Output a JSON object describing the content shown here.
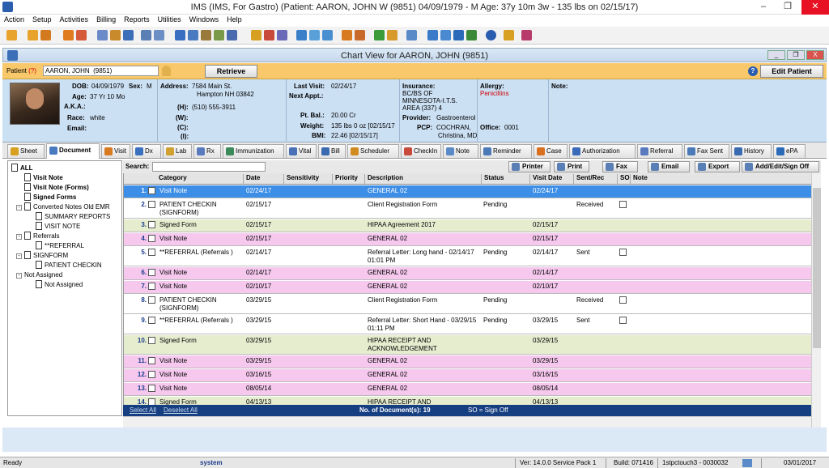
{
  "app": {
    "title": "IMS (IMS, For Gastro)    (Patient: AARON, JOHN W (9851) 04/09/1979 - M Age: 37y 10m 3w - 135 lbs on 02/15/17)",
    "window_controls": [
      "–",
      "❐",
      "✕"
    ]
  },
  "menu": [
    "Action",
    "Setup",
    "Activities",
    "Billing",
    "Reports",
    "Utilities",
    "Windows",
    "Help"
  ],
  "chart_window": {
    "title": "Chart View for AARON, JOHN  (9851)",
    "controls": [
      "_",
      "❐",
      "X"
    ]
  },
  "patient_bar": {
    "label": "Patient",
    "q": "(?)",
    "value": "AARON, JOHN  (9851)",
    "retrieve": "Retrieve",
    "help": "?",
    "edit_patient": "Edit Patient"
  },
  "info": {
    "dob_label": "DOB:",
    "dob": "04/09/1979",
    "sex_label": "Sex:",
    "sex": "M",
    "age_label": "Age:",
    "age": "37 Yr 10 Mo",
    "aka_label": "A.K.A.:",
    "race_label": "Race:",
    "race": "white",
    "email_label": "Email:",
    "address_label": "Address:",
    "address1": "7584 Main St.",
    "address2": "Hampton  NH  03842",
    "h_label": "(H):",
    "h": "(510) 555-3911",
    "w_label": "(W):",
    "c_label": "(C):",
    "i_label": "(I):",
    "last_visit_label": "Last Visit:",
    "last_visit": "02/24/17",
    "next_appt_label": "Next Appt.:",
    "pt_bal_label": "Pt. Bal.:",
    "pt_bal": "20.00 Cr",
    "weight_label": "Weight:",
    "weight": "135 lbs 0 oz [02/15/17",
    "bmi_label": "BMI:",
    "bmi": "22.46 [02/15/17]",
    "insurance_label": "Insurance:",
    "insurance1": "BC/BS OF",
    "insurance2": "MINNESOTA-I.T.S.",
    "insurance3": "AREA  (337)    4",
    "provider_label": "Provider:",
    "provider": "Gastroenterol",
    "pcp_label": "PCP:",
    "pcp1": "COCHRAN,",
    "pcp2": "Christina, MD",
    "allergy_label": "Allergy:",
    "allergy": "Penicillins",
    "office_label": "Office:",
    "office": "0001",
    "note_label": "Note:"
  },
  "tabs": [
    "Sheet",
    "Document",
    "Visit",
    "Dx",
    "Lab",
    "Rx",
    "Immunization",
    "Vital",
    "Bill",
    "Scheduler",
    "CheckIn",
    "Note",
    "Reminder",
    "Case",
    "Authorization",
    "Referral",
    "Fax Sent",
    "History",
    "ePA"
  ],
  "tab_dx_prefix": "Dx",
  "tree": {
    "all": "ALL",
    "visit_note": "Visit Note",
    "visit_note_forms": "Visit Note (Forms)",
    "signed_forms": "Signed Forms",
    "converted": "Converted Notes Old EMR",
    "summary_reports": "SUMMARY REPORTS",
    "visit_note2": "VISIT NOTE",
    "referrals": "Referrals",
    "referral_item": "**REFERRAL",
    "signform": "SIGNFORM",
    "patient_checkin": "PATIENT CHECKIN",
    "not_assigned": "Not Assigned",
    "not_assigned2": "Not Assigned"
  },
  "search": {
    "label": "Search:",
    "printer": "Printer",
    "print": "Print",
    "fax": "Fax",
    "email": "Email",
    "export": "Export",
    "add_edit_sign": "Add/Edit/Sign Off"
  },
  "columns": [
    "Category",
    "Date",
    "Sensitivity",
    "Priority",
    "Description",
    "Status",
    "Visit Date",
    "Sent/Rec",
    "SO",
    "Note"
  ],
  "rows": [
    {
      "num": "1.",
      "category": "Visit Note",
      "date": "02/24/17",
      "description": "GENERAL 02",
      "status": "",
      "visit_date": "02/24/17",
      "sent": "",
      "so": false,
      "bg": "#3d8ee6",
      "selected": true
    },
    {
      "num": "2.",
      "category": "PATIENT CHECKIN (SIGNFORM)",
      "date": "02/15/17",
      "description": "Client Registration Form",
      "status": "Pending",
      "visit_date": "",
      "sent": "Received",
      "so": true,
      "bg": "#ffffff"
    },
    {
      "num": "3.",
      "category": "Signed Form",
      "date": "02/15/17",
      "description": "HIPAA Agreement 2017",
      "status": "",
      "visit_date": "02/15/17",
      "sent": "",
      "so": false,
      "bg": "#e6edcf"
    },
    {
      "num": "4.",
      "category": "Visit Note",
      "date": "02/15/17",
      "description": "GENERAL 02",
      "status": "",
      "visit_date": "02/15/17",
      "sent": "",
      "so": false,
      "bg": "#f6c8ee"
    },
    {
      "num": "5.",
      "category": "**REFERRAL  (Referrals )",
      "date": "02/14/17",
      "description": "Referral Letter: Long hand - 02/14/17 01:01 PM",
      "status": "Pending",
      "visit_date": "02/14/17",
      "sent": "Sent",
      "so": true,
      "bg": "#ffffff"
    },
    {
      "num": "6.",
      "category": "Visit Note",
      "date": "02/14/17",
      "description": "GENERAL 02",
      "status": "",
      "visit_date": "02/14/17",
      "sent": "",
      "so": false,
      "bg": "#f6c8ee"
    },
    {
      "num": "7.",
      "category": "Visit Note",
      "date": "02/10/17",
      "description": "GENERAL 02",
      "status": "",
      "visit_date": "02/10/17",
      "sent": "",
      "so": false,
      "bg": "#f6c8ee"
    },
    {
      "num": "8.",
      "category": "PATIENT CHECKIN (SIGNFORM)",
      "date": "03/29/15",
      "description": "Client Registration Form",
      "status": "Pending",
      "visit_date": "",
      "sent": "Received",
      "so": true,
      "bg": "#ffffff"
    },
    {
      "num": "9.",
      "category": "**REFERRAL  (Referrals )",
      "date": "03/29/15",
      "description": "Referral Letter: Short Hand - 03/29/15 01:11 PM",
      "status": "Pending",
      "visit_date": "03/29/15",
      "sent": "Sent",
      "so": true,
      "bg": "#ffffff"
    },
    {
      "num": "10.",
      "category": "Signed Form",
      "date": "03/29/15",
      "description": "HIPAA RECEIPT AND ACKNOWLEDGEMENT",
      "status": "",
      "visit_date": "03/29/15",
      "sent": "",
      "so": false,
      "bg": "#e6edcf"
    },
    {
      "num": "11.",
      "category": "Visit Note",
      "date": "03/29/15",
      "description": "GENERAL 02",
      "status": "",
      "visit_date": "03/29/15",
      "sent": "",
      "so": false,
      "bg": "#f6c8ee"
    },
    {
      "num": "12.",
      "category": "Visit Note",
      "date": "03/16/15",
      "description": "GENERAL 02",
      "status": "",
      "visit_date": "03/16/15",
      "sent": "",
      "so": false,
      "bg": "#f6c8ee"
    },
    {
      "num": "13.",
      "category": "Visit Note",
      "date": "08/05/14",
      "description": "GENERAL 02",
      "status": "",
      "visit_date": "08/05/14",
      "sent": "",
      "so": false,
      "bg": "#f6c8ee"
    },
    {
      "num": "14.",
      "category": "Signed Form",
      "date": "04/13/13",
      "description": "HIPAA RECEIPT AND ACKNOWLEDGEMENT",
      "status": "",
      "visit_date": "04/13/13",
      "sent": "",
      "so": false,
      "bg": "#e6edcf"
    }
  ],
  "footer": {
    "select_all": "Select All",
    "deselect_all": "Deselect All",
    "count_label": "No. of Document(s): 19",
    "so_legend": "SO = Sign Off"
  },
  "status": {
    "ready": "Ready",
    "user": "system",
    "version": "Ver: 14.0.0 Service Pack 1",
    "build": "Build: 071416",
    "server": "1stpctouch3 - 0030032",
    "date": "03/01/2017"
  }
}
